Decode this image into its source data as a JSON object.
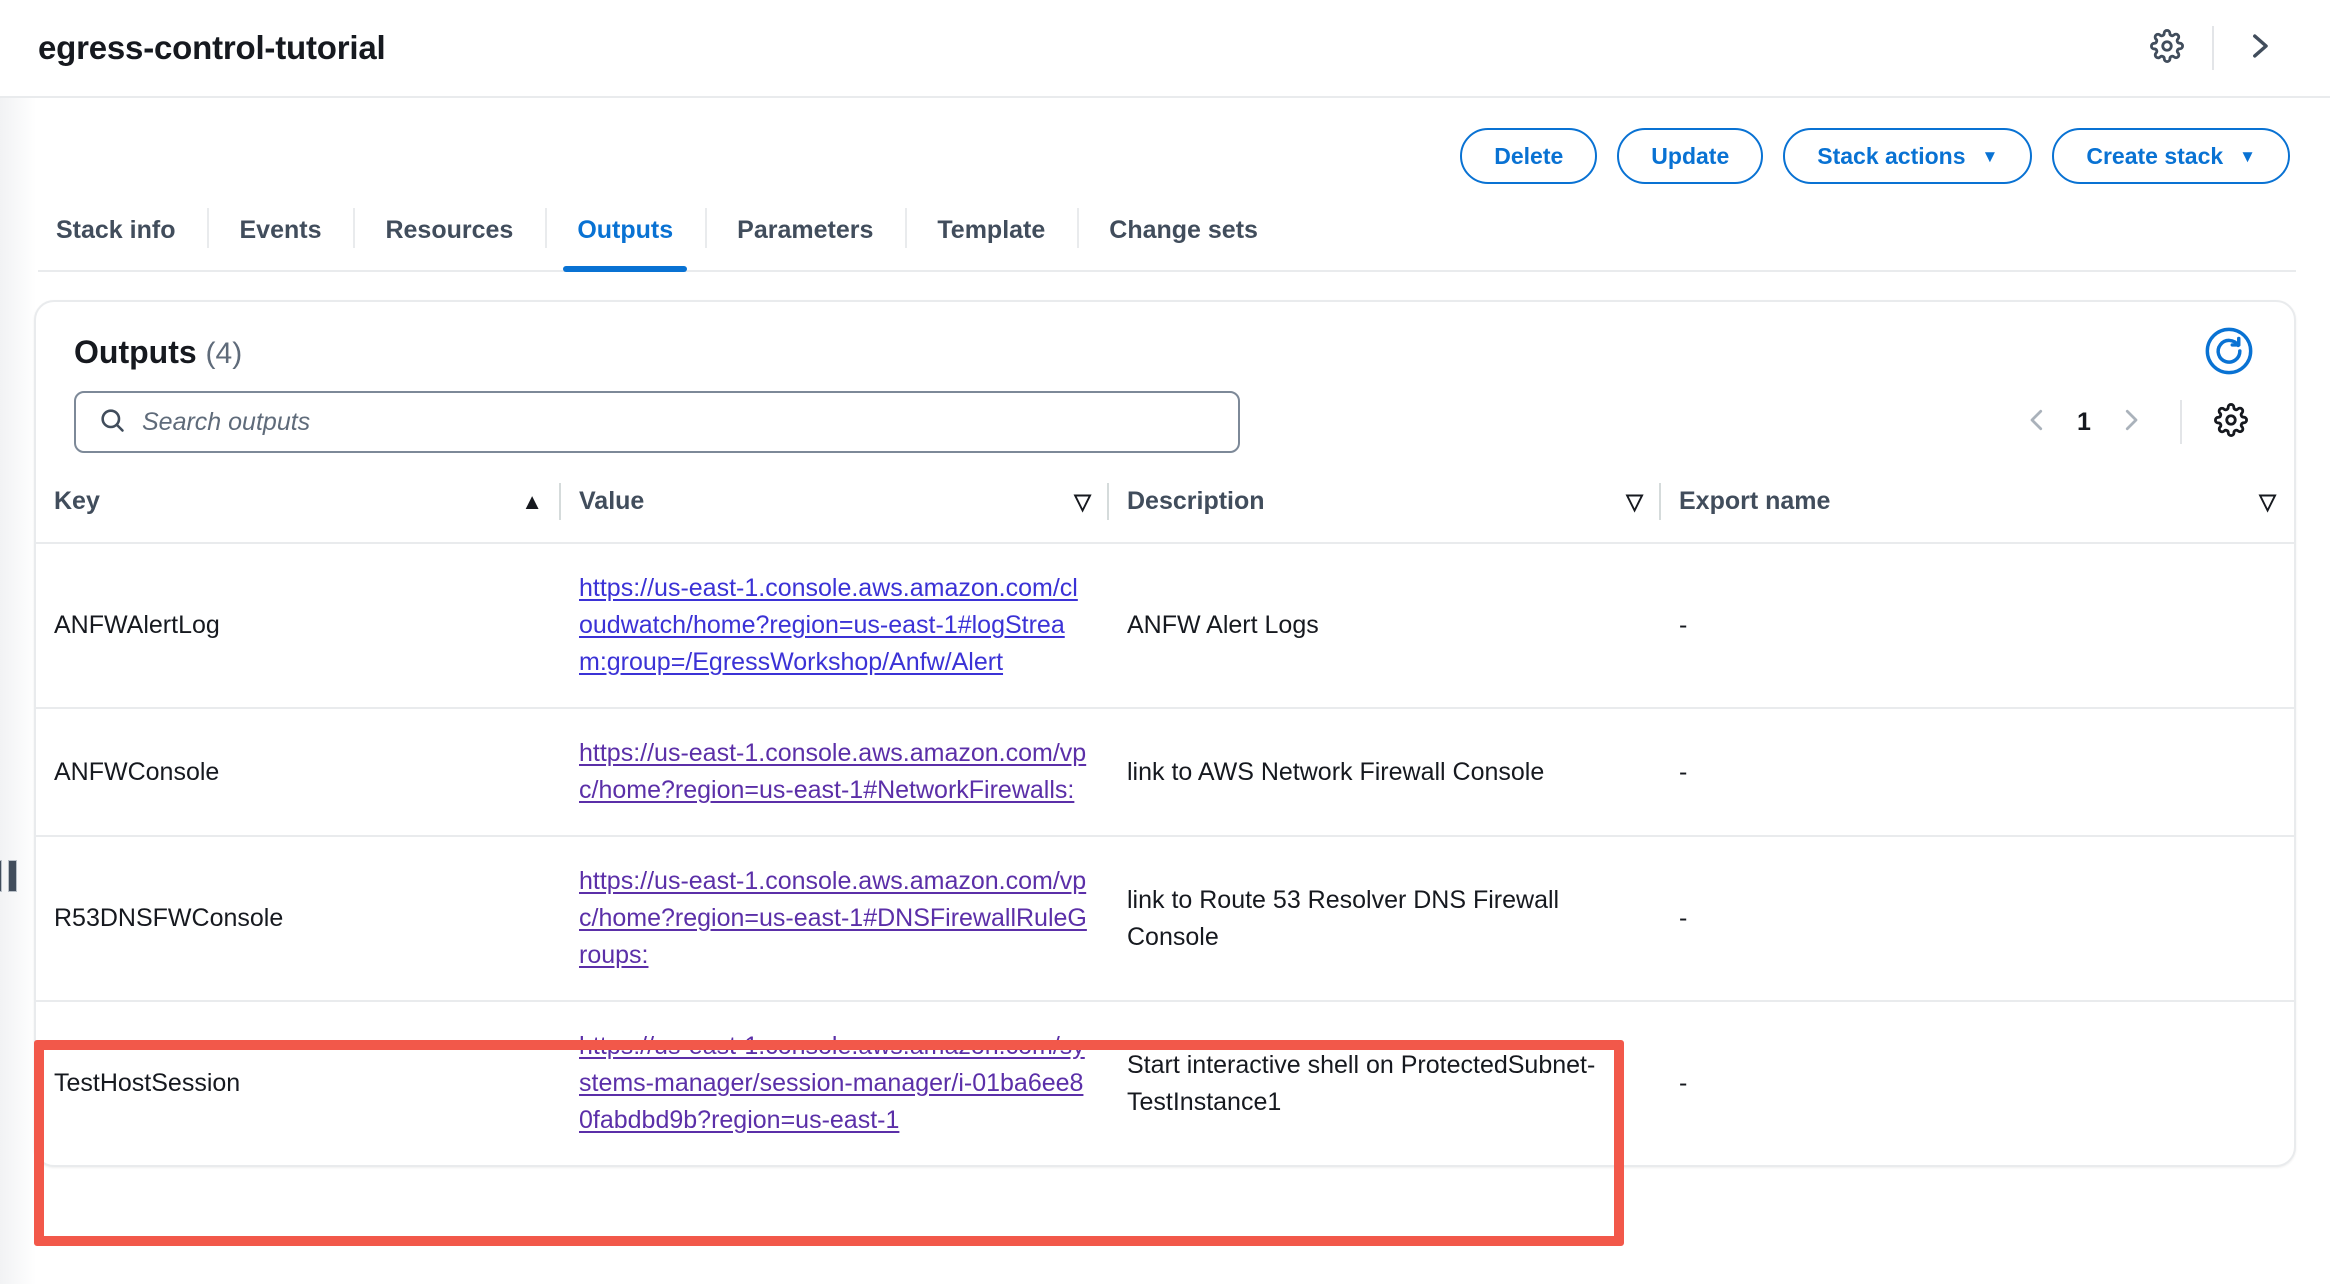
{
  "header": {
    "stack_title": "egress-control-tutorial",
    "settings_icon": "gear-icon",
    "expand_icon": "chevron-right-icon"
  },
  "actions": {
    "delete_label": "Delete",
    "update_label": "Update",
    "stack_actions_label": "Stack actions",
    "create_stack_label": "Create stack",
    "caret": "▼"
  },
  "tabs": [
    {
      "label": "Stack info",
      "active": false
    },
    {
      "label": "Events",
      "active": false
    },
    {
      "label": "Resources",
      "active": false
    },
    {
      "label": "Outputs",
      "active": true
    },
    {
      "label": "Parameters",
      "active": false
    },
    {
      "label": "Template",
      "active": false
    },
    {
      "label": "Change sets",
      "active": false
    }
  ],
  "panel": {
    "title": "Outputs",
    "count": "(4)",
    "refresh_icon": "refresh-icon",
    "search": {
      "placeholder": "Search outputs",
      "value": "",
      "icon": "search-icon"
    },
    "pagination": {
      "prev_icon": "chevron-left-icon",
      "page": "1",
      "next_icon": "chevron-right-icon",
      "settings_icon": "gear-icon"
    }
  },
  "table": {
    "columns": [
      {
        "label": "Key",
        "sort": "▲",
        "sort_state": "ascending"
      },
      {
        "label": "Value",
        "sort": "▽",
        "sort_state": "none"
      },
      {
        "label": "Description",
        "sort": "▽",
        "sort_state": "none"
      },
      {
        "label": "Export name",
        "sort": "▽",
        "sort_state": "none"
      }
    ],
    "rows": [
      {
        "key": "ANFWAlertLog",
        "value": "https://us-east-1.console.aws.amazon.com/cloudwatch/home?region=us-east-1#logStream:group=/EgressWorkshop/Anfw/Alert",
        "description": "ANFW Alert Logs",
        "export_name": "-",
        "link_state": "unvisited"
      },
      {
        "key": "ANFWConsole",
        "value": "https://us-east-1.console.aws.amazon.com/vpc/home?region=us-east-1#NetworkFirewalls:",
        "description": "link to AWS Network Firewall Console",
        "export_name": "-",
        "link_state": "visited"
      },
      {
        "key": "R53DNSFWConsole",
        "value": "https://us-east-1.console.aws.amazon.com/vpc/home?region=us-east-1#DNSFirewallRuleGroups:",
        "description": "link to Route 53 Resolver DNS Firewall Console",
        "export_name": "-",
        "link_state": "visited"
      },
      {
        "key": "TestHostSession",
        "value": "https://us-east-1.console.aws.amazon.com/systems-manager/session-manager/i-01ba6ee80fabdbd9b?region=us-east-1",
        "description": "Start interactive shell on ProtectedSubnet-TestInstance1",
        "export_name": "-",
        "link_state": "visited",
        "highlighted": true
      }
    ]
  },
  "colors": {
    "accent_blue": "#0972d3",
    "link_unvisited": "#3b32d6",
    "link_visited": "#5b2fa8",
    "highlight_red": "#f2584a",
    "text_dark": "#16191f"
  }
}
